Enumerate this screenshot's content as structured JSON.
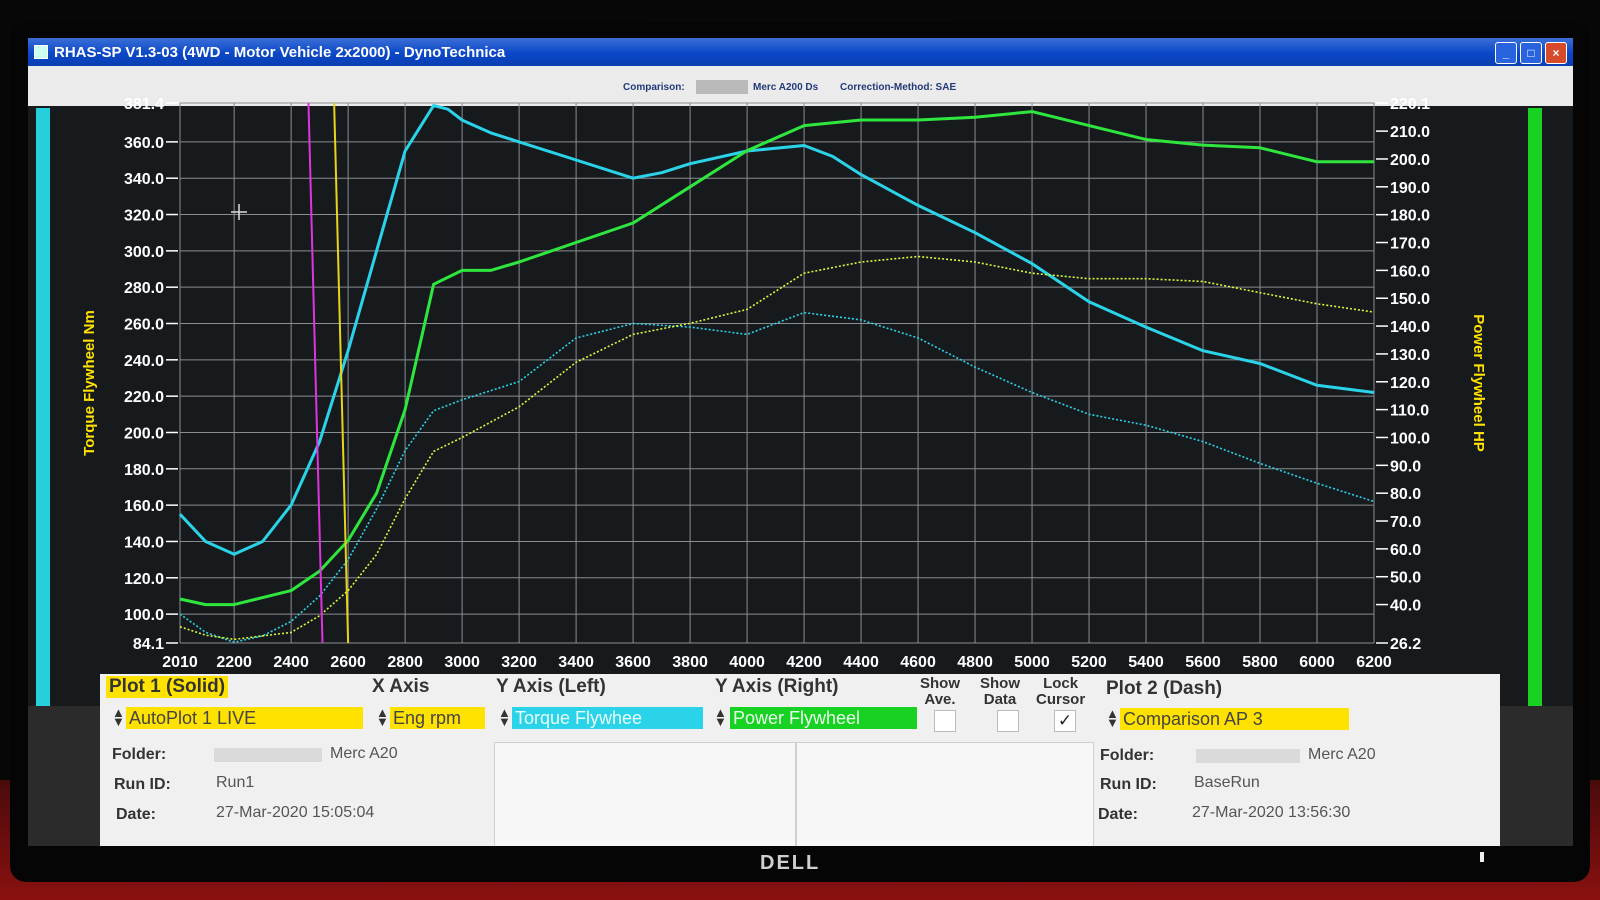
{
  "window": {
    "title": "RHAS-SP V1.3-03  (4WD - Motor Vehicle 2x2000) - DynoTechnica",
    "buttons": {
      "minimize": "_",
      "maximize": "□",
      "close": "×"
    }
  },
  "info_bar": {
    "comparison_label": "Comparison:",
    "comparison_value": "Merc A200 Ds",
    "correction_method": "Correction-Method: SAE"
  },
  "chart_data": {
    "type": "line",
    "xlabel": "",
    "ylabel_left": "Torque Flywheel Nm",
    "ylabel_right": "Power Flywheel HP",
    "xlim": [
      2010,
      6200
    ],
    "ylim_left": [
      84.1,
      381.4
    ],
    "ylim_right": [
      26.2,
      220.1
    ],
    "x_ticks": [
      "2010",
      "2200",
      "2400",
      "2600",
      "2800",
      "3000",
      "3200",
      "3400",
      "3600",
      "3800",
      "4000",
      "4200",
      "4400",
      "4600",
      "4800",
      "5000",
      "5200",
      "5400",
      "5600",
      "5800",
      "6000",
      "6200"
    ],
    "y_left_ticks": [
      "381.4",
      "360.0",
      "340.0",
      "320.0",
      "300.0",
      "280.0",
      "260.0",
      "240.0",
      "220.0",
      "200.0",
      "180.0",
      "160.0",
      "140.0",
      "120.0",
      "100.0",
      "84.1"
    ],
    "y_right_ticks": [
      "220.1",
      "210.0",
      "200.0",
      "190.0",
      "180.0",
      "170.0",
      "160.0",
      "150.0",
      "140.0",
      "130.0",
      "120.0",
      "110.0",
      "100.0",
      "90.0",
      "80.0",
      "70.0",
      "60.0",
      "50.0",
      "40.0",
      "26.2"
    ],
    "grid": true,
    "cursor_lines": [
      {
        "name": "magenta cursor",
        "x": 2510,
        "color": "#e033e0"
      },
      {
        "name": "yellow cursor",
        "x": 2600,
        "color": "#e8d21a"
      }
    ],
    "series": [
      {
        "plot": "Plot 1 (Solid)",
        "quantity": "Torque Flywheel",
        "axis": "left",
        "style": "solid",
        "color": "#2ad3e8",
        "x": [
          2010,
          2100,
          2200,
          2300,
          2400,
          2500,
          2600,
          2700,
          2800,
          2900,
          2950,
          3000,
          3100,
          3200,
          3400,
          3600,
          3700,
          3800,
          4000,
          4200,
          4300,
          4400,
          4600,
          4800,
          5000,
          5200,
          5400,
          5600,
          5800,
          6000,
          6200
        ],
        "y": [
          155,
          140,
          133,
          140,
          160,
          195,
          245,
          300,
          355,
          380,
          378,
          372,
          365,
          360,
          350,
          340,
          343,
          348,
          355,
          358,
          352,
          342,
          325,
          310,
          293,
          272,
          258,
          245,
          238,
          226,
          222
        ]
      },
      {
        "plot": "Plot 1 (Solid)",
        "quantity": "Power Flywheel",
        "axis": "right",
        "style": "solid",
        "color": "#2ee63e",
        "x": [
          2010,
          2100,
          2200,
          2400,
          2500,
          2600,
          2700,
          2800,
          2900,
          3000,
          3100,
          3200,
          3400,
          3600,
          3800,
          4000,
          4200,
          4400,
          4600,
          4800,
          5000,
          5200,
          5400,
          5600,
          5800,
          6000,
          6200
        ],
        "y": [
          42,
          40,
          40,
          45,
          52,
          63,
          80,
          110,
          155,
          160,
          160,
          163,
          170,
          177,
          190,
          203,
          212,
          214,
          214,
          215,
          217,
          212,
          207,
          205,
          204,
          199,
          199
        ]
      },
      {
        "plot": "Plot 2 (Dash)",
        "quantity": "Torque Flywheel",
        "axis": "left",
        "style": "dash",
        "color": "#2ad3e8",
        "x": [
          2010,
          2100,
          2200,
          2300,
          2400,
          2500,
          2600,
          2700,
          2800,
          2900,
          3000,
          3200,
          3400,
          3600,
          3800,
          4000,
          4200,
          4400,
          4600,
          4800,
          5000,
          5200,
          5400,
          5600,
          5800,
          6000,
          6200
        ],
        "y": [
          100,
          90,
          84.5,
          88,
          96,
          110,
          130,
          158,
          190,
          212,
          218,
          228,
          252,
          260,
          258,
          254,
          266,
          262,
          252,
          236,
          222,
          210,
          204,
          195,
          183,
          172,
          162
        ]
      },
      {
        "plot": "Plot 2 (Dash)",
        "quantity": "Power Flywheel",
        "axis": "right",
        "style": "dash",
        "color": "#d8f83a",
        "x": [
          2010,
          2100,
          2200,
          2400,
          2500,
          2600,
          2700,
          2800,
          2900,
          3000,
          3200,
          3400,
          3600,
          3800,
          4000,
          4200,
          4400,
          4600,
          4800,
          5000,
          5200,
          5400,
          5600,
          5800,
          6000,
          6200
        ],
        "y": [
          32,
          29,
          27.5,
          30,
          36,
          45,
          58,
          78,
          95,
          100,
          111,
          127,
          137,
          141,
          146,
          159,
          163,
          165,
          163,
          159,
          157,
          157,
          156,
          152,
          148,
          145
        ]
      }
    ]
  },
  "panel": {
    "plot1": {
      "header": "Plot 1 (Solid)",
      "select": "AutoPlot 1 LIVE",
      "folder_label": "Folder:",
      "folder_value": "Merc A20",
      "runid_label": "Run ID:",
      "runid_value": "Run1",
      "date_label": "Date:",
      "date_value": "27-Mar-2020  15:05:04"
    },
    "xaxis": {
      "header": "X Axis",
      "select": "Eng rpm"
    },
    "yleft": {
      "header": "Y Axis (Left)",
      "select": "Torque Flywhee"
    },
    "yright": {
      "header": "Y Axis (Right)",
      "select": "Power Flywheel"
    },
    "show_ave": {
      "line1": "Show",
      "line2": "Ave."
    },
    "show_data": {
      "line1": "Show",
      "line2": "Data"
    },
    "lock_cursor": {
      "line1": "Lock",
      "line2": "Cursor",
      "check": "✓"
    },
    "plot2": {
      "header": "Plot 2 (Dash)",
      "select": "Comparison AP 3",
      "folder_label": "Folder:",
      "folder_value": "Merc A20",
      "runid_label": "Run ID:",
      "runid_value": "BaseRun",
      "date_label": "Date:",
      "date_value": "27-Mar-2020  13:56:30"
    }
  },
  "monitor": {
    "brand": "DELL"
  }
}
